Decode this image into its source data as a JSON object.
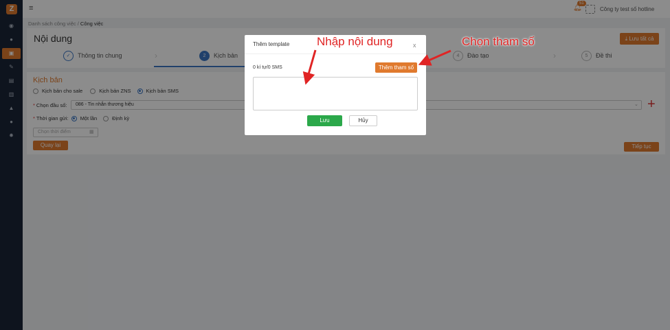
{
  "app": {
    "logo_letter": "Z",
    "accent": "#e07a2e"
  },
  "topbar": {
    "notification_count": "51",
    "company": "Công ty test số hotline"
  },
  "breadcrumb": {
    "parent": "Danh sách công việc",
    "sep": "/",
    "current": "Công việc"
  },
  "page": {
    "title": "Nội dung",
    "save_all": "Lưu tất cả"
  },
  "steps": [
    {
      "num": "✓",
      "label": "Thông tin chung"
    },
    {
      "num": "2",
      "label": "Kịch bản"
    },
    {
      "num": "4",
      "label": "Đào tạo"
    },
    {
      "num": "5",
      "label": "Đề thi"
    }
  ],
  "form": {
    "section_title": "Kịch bản",
    "type_options": [
      "Kịch bản cho sale",
      "Kịch bản ZNS",
      "Kịch bản SMS"
    ],
    "selected_type": "Kịch bản SMS",
    "number_label": "Chọn đầu số:",
    "number_value": "086 - Tin nhắn thương hiệu",
    "send_time_label": "Thời gian gửi:",
    "send_options": [
      "Một lần",
      "Định kỳ"
    ],
    "selected_send": "Một lần",
    "date_placeholder": "Chọn thời điểm",
    "back_button": "Quay lại",
    "next_button": "Tiếp tục"
  },
  "modal": {
    "title": "Thêm template",
    "close": "x",
    "counter": "0 kí tự/0 SMS",
    "add_param_button": "Thêm tham số",
    "textarea_value": "",
    "save_button": "Lưu",
    "cancel_button": "Hủy"
  },
  "annotations": {
    "content": "Nhập nội dung",
    "param": "Chọn tham số"
  }
}
